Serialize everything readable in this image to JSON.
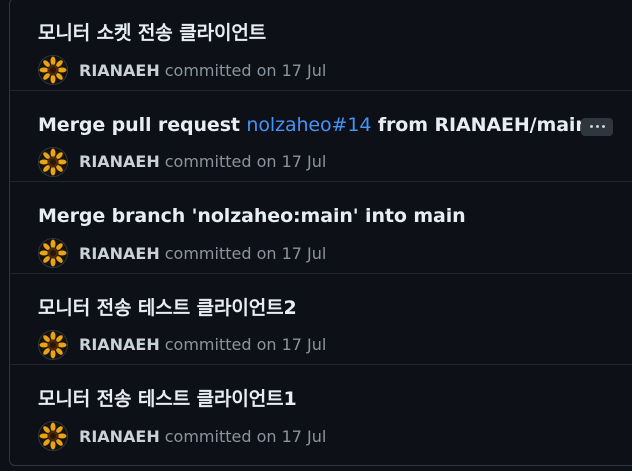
{
  "commits": [
    {
      "title": "모니터 소켓 전송 클라이언트",
      "author": "RIANAEH",
      "action": "committed on 17 Jul"
    },
    {
      "title_prefix": "Merge pull request ",
      "title_link": "nolzaheo#14",
      "title_suffix": " from RIANAEH/main",
      "author": "RIANAEH",
      "action": "committed on 17 Jul",
      "expand_label": "..."
    },
    {
      "title": "Merge branch 'nolzaheo:main' into main",
      "author": "RIANAEH",
      "action": "committed on 17 Jul"
    },
    {
      "title": "모니터 전송 테스트 클라이언트2",
      "author": "RIANAEH",
      "action": "committed on 17 Jul"
    },
    {
      "title": "모니터 전송 테스트 클라이언트1",
      "author": "RIANAEH",
      "action": "committed on 17 Jul"
    }
  ],
  "colors": {
    "background": "#0d1117",
    "border": "#30363d",
    "title": "#e6edf3",
    "link": "#4493f8",
    "muted": "#8b949e"
  },
  "avatar_icon": "sunflower-icon"
}
